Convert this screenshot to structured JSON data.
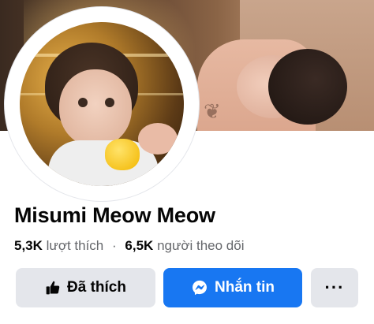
{
  "profile": {
    "name": "Misumi Meow Meow",
    "likes_count": "5,3K",
    "likes_label": "lượt thích",
    "separator": "·",
    "followers_count": "6,5K",
    "followers_label": "người theo dõi"
  },
  "actions": {
    "liked_label": "Đã thích",
    "message_label": "Nhắn tin",
    "more_label": "···"
  },
  "colors": {
    "primary": "#1877f2",
    "secondary_button": "#e4e6eb",
    "text_primary": "#050505",
    "text_secondary": "#65676b"
  },
  "icons": {
    "liked": "thumbs-up-icon",
    "message": "messenger-icon",
    "more": "more-icon"
  }
}
